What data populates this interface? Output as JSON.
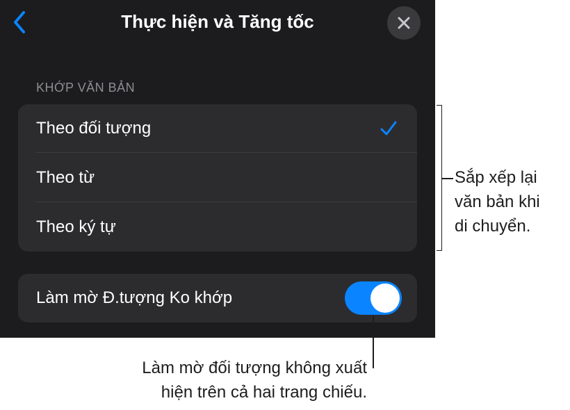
{
  "header": {
    "title": "Thực hiện và Tăng tốc",
    "back_icon": "chevron-left-icon",
    "close_icon": "close-icon"
  },
  "text_fit": {
    "section_label": "KHỚP VĂN BẢN",
    "options": [
      {
        "label": "Theo đối tượng",
        "selected": true
      },
      {
        "label": "Theo từ",
        "selected": false
      },
      {
        "label": "Theo ký tự",
        "selected": false
      }
    ]
  },
  "fade_toggle": {
    "label": "Làm mờ Đ.tượng Ko khớp",
    "on": true
  },
  "callouts": {
    "right": [
      "Sắp xếp lại",
      "văn bản khi",
      "di chuyển."
    ],
    "bottom": [
      "Làm mờ đối tượng không xuất",
      "hiện trên cả hai trang chiếu."
    ]
  },
  "colors": {
    "accent": "#0a84ff",
    "panel_bg": "#1c1c1e",
    "group_bg": "#2c2c2e"
  }
}
